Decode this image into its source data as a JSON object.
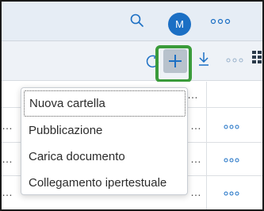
{
  "shell": {
    "avatar_initial": "M",
    "search_icon": "search-icon",
    "overflow_icon": "overflow-dots-icon"
  },
  "toolbar": {
    "refresh_icon": "refresh-icon",
    "add_icon": "plus-icon",
    "download_icon": "download-icon",
    "more_icon": "overflow-dots-icon",
    "grid_icon": "grid-icon",
    "highlight_color": "#3a9b3a"
  },
  "table": {
    "rows": [
      {
        "left_text": "",
        "right_text": "…",
        "has_actions": false
      },
      {
        "left_text": "…",
        "right_text": "…",
        "has_actions": true
      },
      {
        "left_text": "…",
        "right_text": "…",
        "has_actions": true
      },
      {
        "left_text": "…",
        "right_text": "…",
        "has_actions": true
      }
    ]
  },
  "menu": {
    "items": [
      {
        "label": "Nuova cartella"
      },
      {
        "label": "Pubblicazione"
      },
      {
        "label": "Carica documento"
      },
      {
        "label": "Collegamento ipertestuale"
      }
    ]
  },
  "colors": {
    "shellbar_bg": "#e6edf5",
    "avatar_bg": "#1b6fc4",
    "icon_color": "#1b6fc4"
  }
}
